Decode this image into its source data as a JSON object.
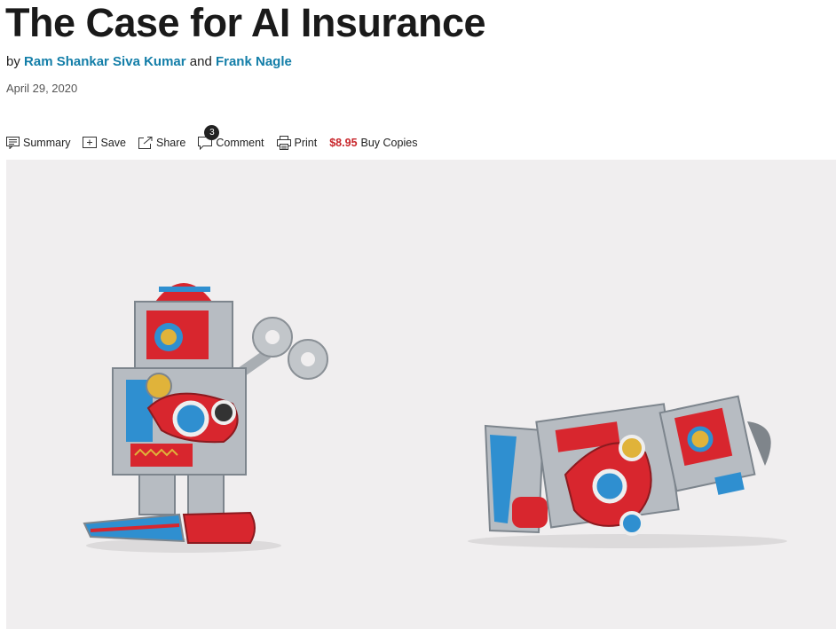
{
  "article": {
    "title": "The Case for AI Insurance",
    "by_prefix": "by",
    "author1": "Ram Shankar Siva Kumar",
    "and": "and",
    "author2": "Frank Nagle",
    "date": "April 29, 2020"
  },
  "toolbar": {
    "summary": "Summary",
    "save": "Save",
    "share": "Share",
    "comment": "Comment",
    "comment_count": "3",
    "print": "Print",
    "price": "$8.95",
    "buy": "Buy Copies"
  },
  "colors": {
    "link": "#137ea8",
    "price": "#c8262b",
    "hero_bg": "#f0eeef"
  },
  "icons": [
    "summary-icon",
    "save-icon",
    "share-icon",
    "comment-icon",
    "print-icon"
  ]
}
